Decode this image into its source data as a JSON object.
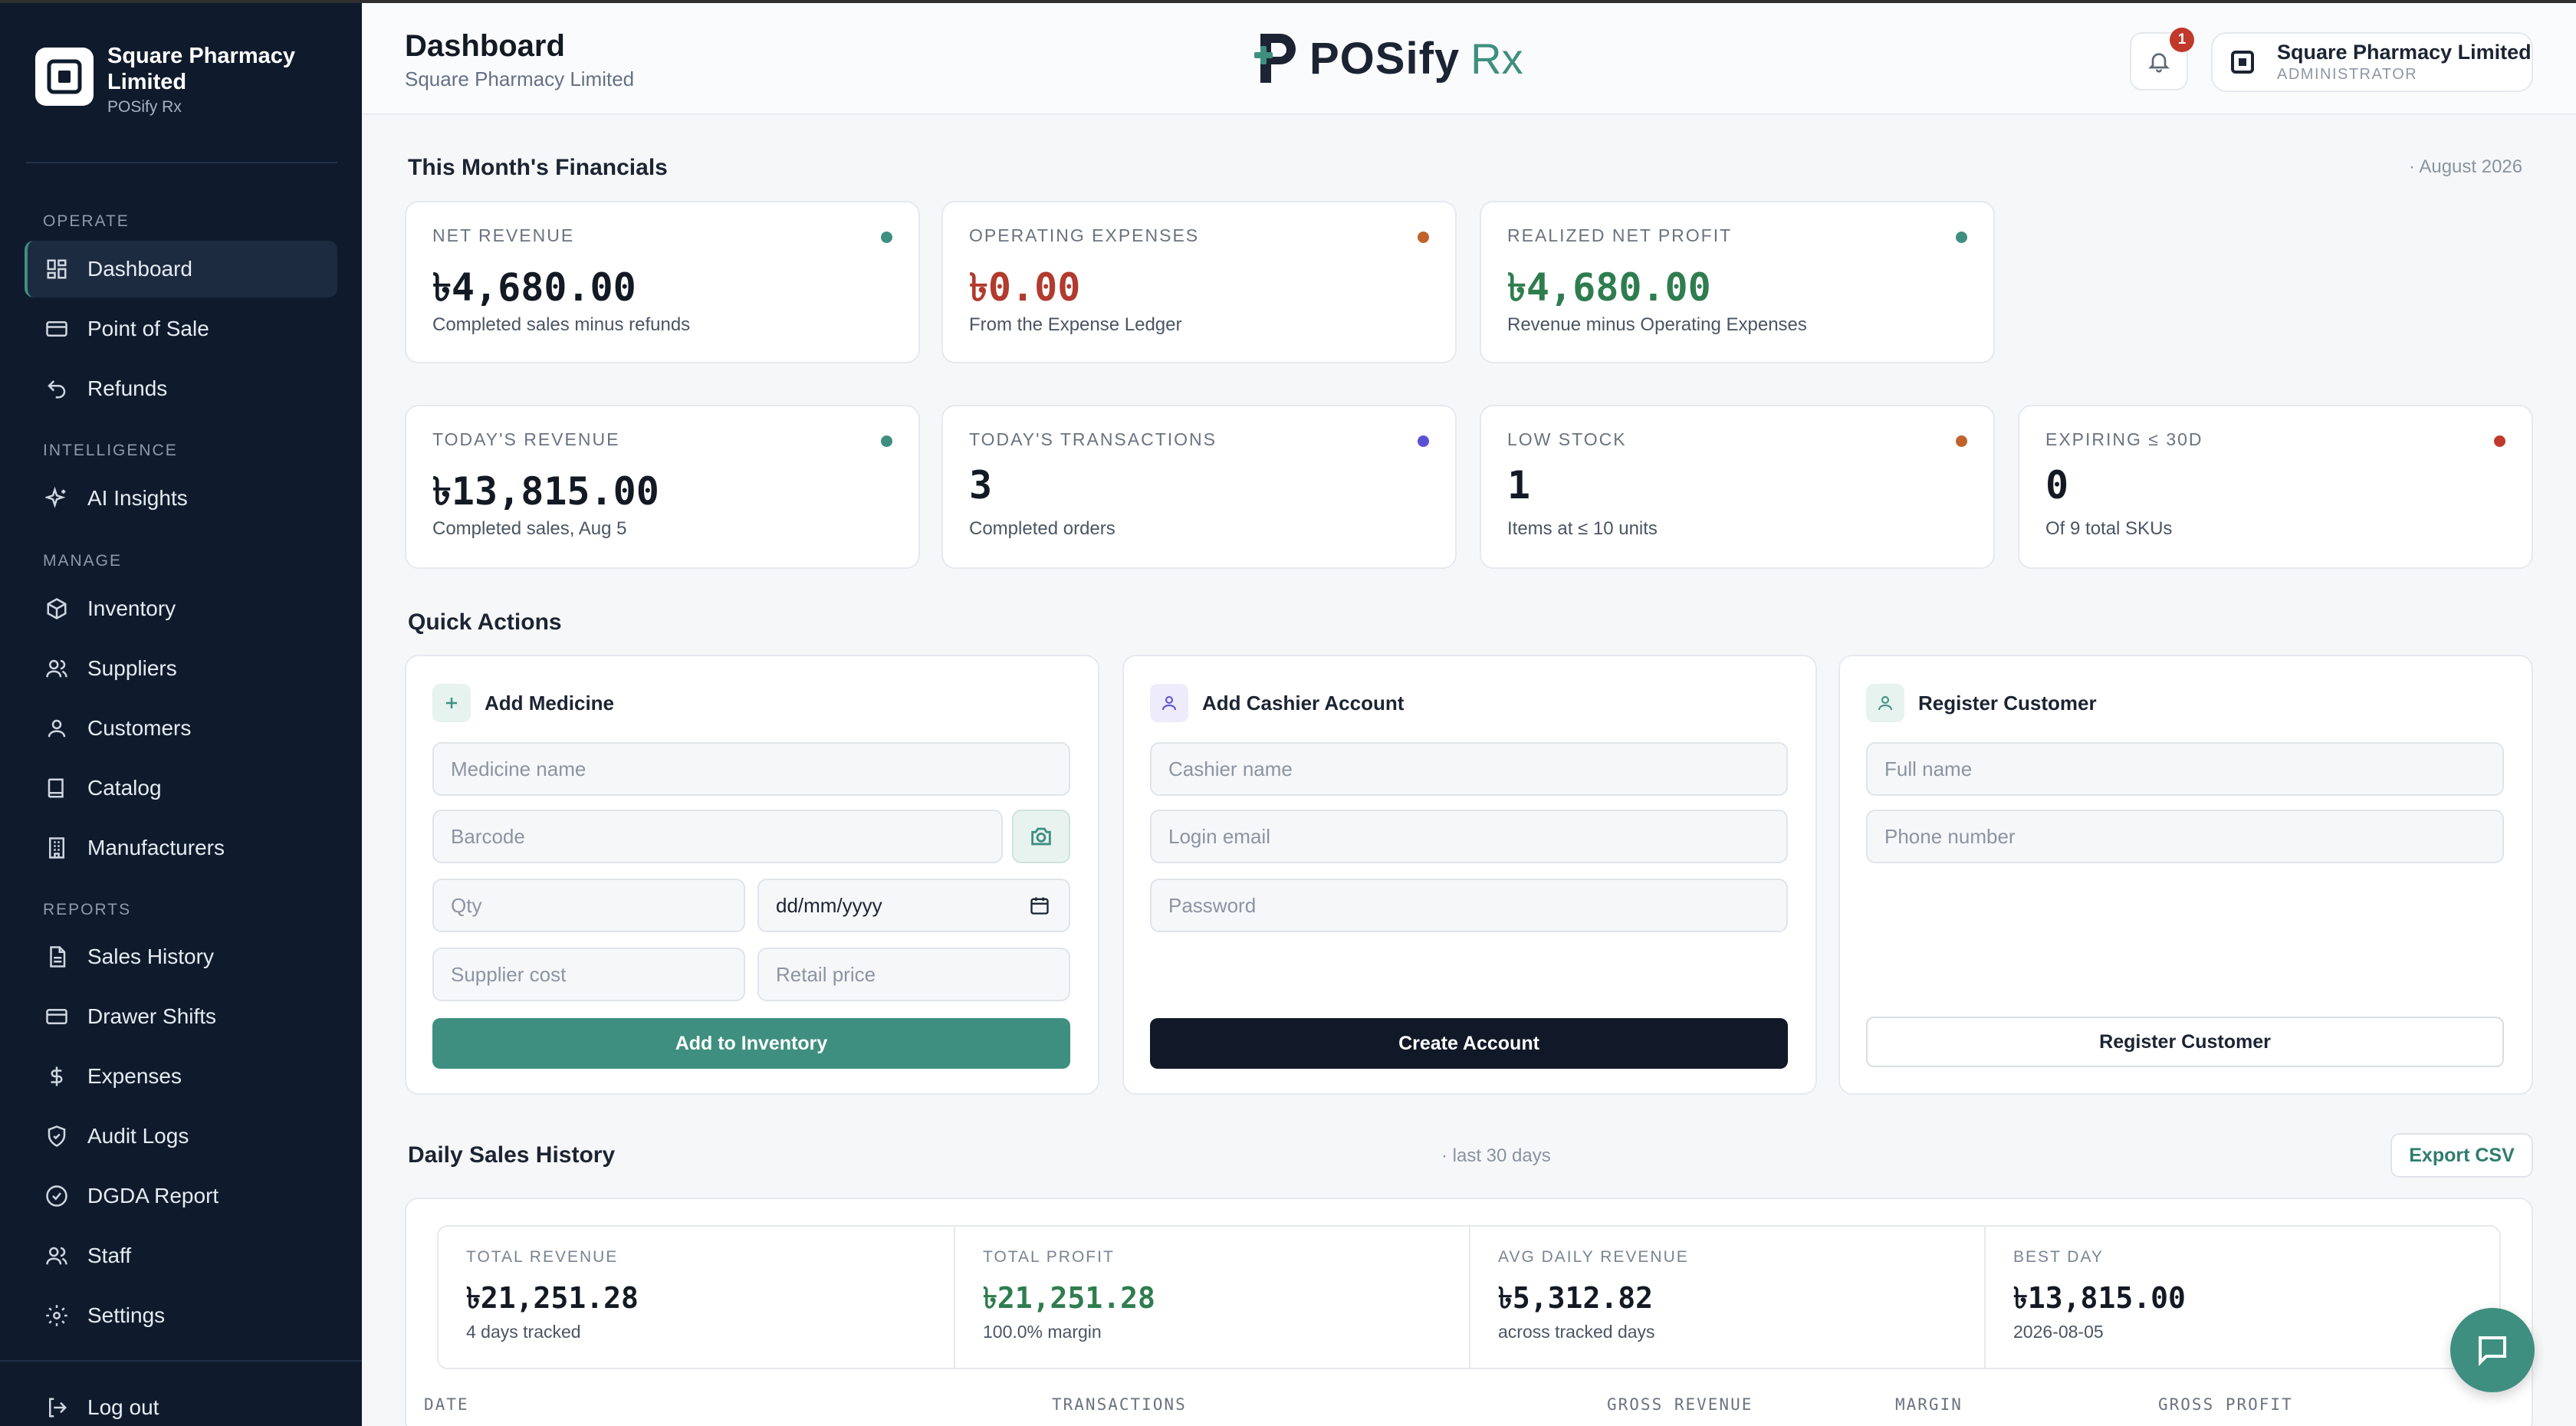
{
  "brand": {
    "name": "Square Pharmacy Limited",
    "sub": "POSify Rx"
  },
  "sidebar": {
    "sections": [
      "OPERATE",
      "INTELLIGENCE",
      "MANAGE",
      "REPORTS"
    ],
    "items": [
      {
        "label": "Dashboard",
        "icon": "dashboard-icon"
      },
      {
        "label": "Point of Sale",
        "icon": "card-icon"
      },
      {
        "label": "Refunds",
        "icon": "undo-icon"
      },
      {
        "label": "AI Insights",
        "icon": "sparkles-icon"
      },
      {
        "label": "Inventory",
        "icon": "box-icon"
      },
      {
        "label": "Suppliers",
        "icon": "users-icon"
      },
      {
        "label": "Customers",
        "icon": "user-icon"
      },
      {
        "label": "Catalog",
        "icon": "book-icon"
      },
      {
        "label": "Manufacturers",
        "icon": "building-icon"
      },
      {
        "label": "Sales History",
        "icon": "file-icon"
      },
      {
        "label": "Drawer Shifts",
        "icon": "drawer-icon"
      },
      {
        "label": "Expenses",
        "icon": "dollar-icon"
      },
      {
        "label": "Audit Logs",
        "icon": "shield-icon"
      },
      {
        "label": "DGDA Report",
        "icon": "report-icon"
      },
      {
        "label": "Staff",
        "icon": "staff-icon"
      },
      {
        "label": "Settings",
        "icon": "gear-icon"
      },
      {
        "label": "Log out",
        "icon": "logout-icon"
      }
    ]
  },
  "header": {
    "title": "Dashboard",
    "subtitle": "Square Pharmacy Limited",
    "logo_main": "POSify",
    "logo_rx": "Rx",
    "notification_count": "1",
    "user_name": "Square Pharmacy Limited",
    "user_role": "ADMINISTRATOR"
  },
  "financials": {
    "title": "This Month's Financials",
    "period": "· August 2026",
    "cards": [
      {
        "label": "NET REVENUE",
        "value": "৳4,680.00",
        "caption": "Completed sales minus refunds",
        "dot": "#3f8f80",
        "value_color": "#141a24"
      },
      {
        "label": "OPERATING EXPENSES",
        "value": "৳0.00",
        "caption": "From the Expense Ledger",
        "dot": "#c0622b",
        "value_color": "#b23a2e"
      },
      {
        "label": "REALIZED NET PROFIT",
        "value": "৳4,680.00",
        "caption": "Revenue minus Operating Expenses",
        "dot": "#3f8f80",
        "value_color": "#2f7d4f"
      }
    ]
  },
  "today": {
    "cards": [
      {
        "label": "TODAY'S REVENUE",
        "value": "৳13,815.00",
        "caption": "Completed sales, Aug 5",
        "dot": "#3f8f80"
      },
      {
        "label": "TODAY'S TRANSACTIONS",
        "value": "3",
        "caption": "Completed orders",
        "dot": "#5b4fd6"
      },
      {
        "label": "LOW STOCK",
        "value": "1",
        "caption": "Items at ≤ 10 units",
        "dot": "#c0622b"
      },
      {
        "label": "EXPIRING ≤ 30D",
        "value": "0",
        "caption": "Of 9 total SKUs",
        "dot": "#c0392b"
      }
    ]
  },
  "quick_actions": {
    "title": "Quick Actions",
    "add_medicine": {
      "title": "Add Medicine",
      "name_placeholder": "Medicine name",
      "barcode_placeholder": "Barcode",
      "qty_placeholder": "Qty",
      "date_value": "dd/mm/yyyy",
      "supplier_cost_placeholder": "Supplier cost",
      "retail_price_placeholder": "Retail price",
      "button": "Add to Inventory"
    },
    "add_cashier": {
      "title": "Add Cashier Account",
      "name_placeholder": "Cashier name",
      "email_placeholder": "Login email",
      "password_placeholder": "Password",
      "button": "Create Account"
    },
    "register_customer": {
      "title": "Register Customer",
      "name_placeholder": "Full name",
      "phone_placeholder": "Phone number",
      "button": "Register Customer"
    }
  },
  "daily_sales": {
    "title": "Daily Sales History",
    "note": "· last 30 days",
    "export_label": "Export CSV",
    "summary": [
      {
        "label": "TOTAL REVENUE",
        "value": "৳21,251.28",
        "caption": "4 days tracked",
        "value_color": "#141a24"
      },
      {
        "label": "TOTAL PROFIT",
        "value": "৳21,251.28",
        "caption": "100.0% margin",
        "value_color": "#2f7d4f"
      },
      {
        "label": "AVG DAILY REVENUE",
        "value": "৳5,312.82",
        "caption": "across tracked days",
        "value_color": "#141a24"
      },
      {
        "label": "BEST DAY",
        "value": "৳13,815.00",
        "caption": "2026-08-05",
        "value_color": "#141a24"
      }
    ],
    "columns": [
      "DATE",
      "TRANSACTIONS",
      "GROSS REVENUE",
      "MARGIN",
      "GROSS PROFIT"
    ]
  }
}
